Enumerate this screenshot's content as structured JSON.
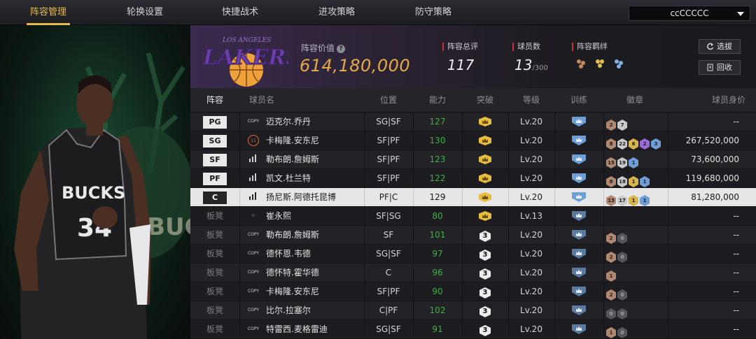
{
  "tabs": [
    "阵容管理",
    "轮换设置",
    "快捷战术",
    "进攻策略",
    "防守策略"
  ],
  "account_dropdown": "ccCCCCC",
  "header": {
    "team_logo_text": "LAKERS",
    "team_logo_subtext": "LOS ANGELES",
    "value_label": "阵容价值",
    "value": "614,180,000",
    "rating_label": "阵容总评",
    "rating_value": "117",
    "count_label": "球员数",
    "count_value": "13",
    "count_max": "/300",
    "bond_label": "阵容羁绊",
    "btn_pick": "选拔",
    "btn_recycle": "回收"
  },
  "columns": [
    "阵容",
    "球员名",
    "位置",
    "能力",
    "突破",
    "等级",
    "训练",
    "徽章",
    "球员身价"
  ],
  "rows": [
    {
      "slot": "PG",
      "tag": "COPY",
      "name": "迈克尔.乔丹",
      "pos": "SG|SF",
      "ability": "127",
      "break": "crown",
      "level": "Lv.20",
      "badges": [
        [
          "2",
          "b-bronze"
        ],
        [
          "7",
          "b-silver"
        ]
      ],
      "price": "--"
    },
    {
      "slot": "SG",
      "tag": "11",
      "name": "卡梅隆.安东尼",
      "pos": "SF|PF",
      "ability": "130",
      "break": "crown",
      "level": "Lv.20",
      "badges": [
        [
          "8",
          "b-bronze"
        ],
        [
          "22",
          "b-silver"
        ],
        [
          "6",
          "b-gold"
        ],
        [
          "2",
          "b-purple"
        ],
        [
          "3",
          "b-blue"
        ]
      ],
      "price": "267,520,000"
    },
    {
      "slot": "SF",
      "tag": "bars",
      "name": "勒布朗.詹姆斯",
      "pos": "SF|PF",
      "ability": "123",
      "break": "crown",
      "level": "Lv.20",
      "badges": [
        [
          "15",
          "b-bronze"
        ],
        [
          "19",
          "b-silver"
        ],
        [
          "1",
          "b-blue"
        ]
      ],
      "price": "73,600,000"
    },
    {
      "slot": "PF",
      "tag": "bars",
      "name": "凯文.杜兰特",
      "pos": "SF|PF",
      "ability": "122",
      "break": "crown",
      "level": "Lv.20",
      "badges": [
        [
          "8",
          "b-bronze"
        ],
        [
          "18",
          "b-silver"
        ],
        [
          "1",
          "b-gold"
        ],
        [
          "1",
          "b-blue"
        ]
      ],
      "price": "119,680,000"
    },
    {
      "slot": "C",
      "tag": "bars",
      "name": "扬尼斯.阿德托昆博",
      "pos": "PF|C",
      "ability": "129",
      "break": "crown",
      "level": "Lv.20",
      "badges": [
        [
          "13",
          "b-bronze"
        ],
        [
          "17",
          "b-silver"
        ],
        [
          "1",
          "b-gold"
        ],
        [
          "1",
          "b-blue"
        ]
      ],
      "price": "81,280,000",
      "selected": true
    },
    {
      "slot": "板凳",
      "tag": "star",
      "name": "崔永熙",
      "pos": "SF|SG",
      "ability": "80",
      "break": "crown",
      "level": "Lv.13",
      "badges": [],
      "price": "--"
    },
    {
      "slot": "板凳",
      "tag": "COPY",
      "name": "勒布朗.詹姆斯",
      "pos": "SF",
      "ability": "101",
      "break": "3",
      "level": "Lv.20",
      "badges": [
        [
          "2",
          "b-bronze"
        ],
        [
          "0",
          "b-gray"
        ]
      ],
      "price": "--"
    },
    {
      "slot": "板凳",
      "tag": "COPY",
      "name": "德怀恩.韦德",
      "pos": "SG|SF",
      "ability": "97",
      "break": "3",
      "level": "Lv.20",
      "badges": [
        [
          "2",
          "b-bronze"
        ],
        [
          "0",
          "b-gray"
        ]
      ],
      "price": "--"
    },
    {
      "slot": "板凳",
      "tag": "COPY",
      "name": "德怀特.霍华德",
      "pos": "C",
      "ability": "96",
      "break": "3",
      "level": "Lv.20",
      "badges": [
        [
          "1",
          "b-bronze"
        ]
      ],
      "price": "--"
    },
    {
      "slot": "板凳",
      "tag": "COPY",
      "name": "卡梅隆.安东尼",
      "pos": "SF|PF",
      "ability": "90",
      "break": "3",
      "level": "Lv.20",
      "badges": [
        [
          "2",
          "b-bronze"
        ],
        [
          "0",
          "b-gray"
        ]
      ],
      "price": "--"
    },
    {
      "slot": "板凳",
      "tag": "COPY",
      "name": "比尔.拉塞尔",
      "pos": "C|PF",
      "ability": "102",
      "break": "3",
      "level": "Lv.20",
      "badges": [
        [
          "0",
          "b-gray"
        ],
        [
          "0",
          "b-gray"
        ]
      ],
      "price": "--"
    },
    {
      "slot": "板凳",
      "tag": "COPY",
      "name": "特雷西.麦格雷迪",
      "pos": "SG|SF",
      "ability": "91",
      "break": "3",
      "level": "Lv.20",
      "badges": [
        [
          "1",
          "b-bronze"
        ],
        [
          "0",
          "b-gray"
        ]
      ],
      "price": "--"
    }
  ],
  "jersey": {
    "team": "BUCKS",
    "number": "34"
  },
  "colors": {
    "accent_gold": "#e8b84a",
    "value_orange": "#e6a94a",
    "ability_green": "#3eb043",
    "lakers_purple": "#552583"
  }
}
